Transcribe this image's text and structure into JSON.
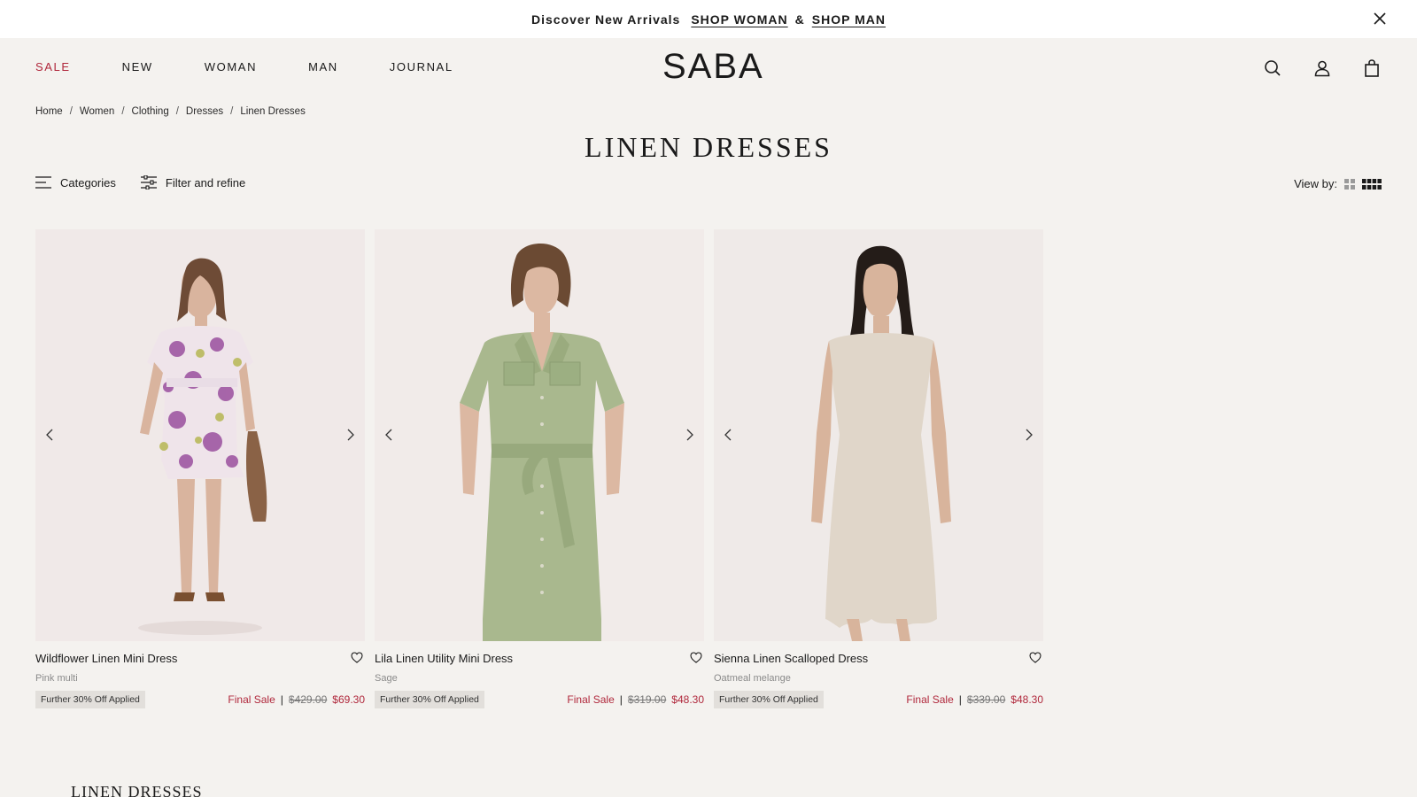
{
  "announcement": {
    "text": "Discover New Arrivals",
    "link_woman": "SHOP WOMAN",
    "amp": "&",
    "link_man": "SHOP MAN"
  },
  "nav": {
    "sale": "SALE",
    "new": "NEW",
    "woman": "WOMAN",
    "man": "MAN",
    "journal": "JOURNAL"
  },
  "brand": "SABA",
  "breadcrumb": [
    "Home",
    "Women",
    "Clothing",
    "Dresses",
    "Linen Dresses"
  ],
  "page_title": "LINEN DRESSES",
  "toolbar": {
    "categories": "Categories",
    "filter": "Filter and refine",
    "view_by": "View by:"
  },
  "products": [
    {
      "name": "Wildflower Linen Mini Dress",
      "color": "Pink multi",
      "promo": "Further 30% Off Applied",
      "final": "Final Sale",
      "was": "$429.00",
      "now": "$69.30"
    },
    {
      "name": "Lila Linen Utility Mini Dress",
      "color": "Sage",
      "promo": "Further 30% Off Applied",
      "final": "Final Sale",
      "was": "$319.00",
      "now": "$48.30"
    },
    {
      "name": "Sienna Linen Scalloped Dress",
      "color": "Oatmeal melange",
      "promo": "Further 30% Off Applied",
      "final": "Final Sale",
      "was": "$339.00",
      "now": "$48.30"
    }
  ],
  "footer_title": "LINEN DRESSES",
  "colors": {
    "background": "#f4f2ef",
    "sale_accent": "#b0283c",
    "promo_badge": "#e2dfdb"
  },
  "icons": [
    "close-icon",
    "search-icon",
    "account-icon",
    "bag-icon",
    "menu-icon",
    "filter-icon",
    "grid-2-icon",
    "grid-4-icon",
    "chevron-left-icon",
    "chevron-right-icon",
    "heart-icon"
  ]
}
